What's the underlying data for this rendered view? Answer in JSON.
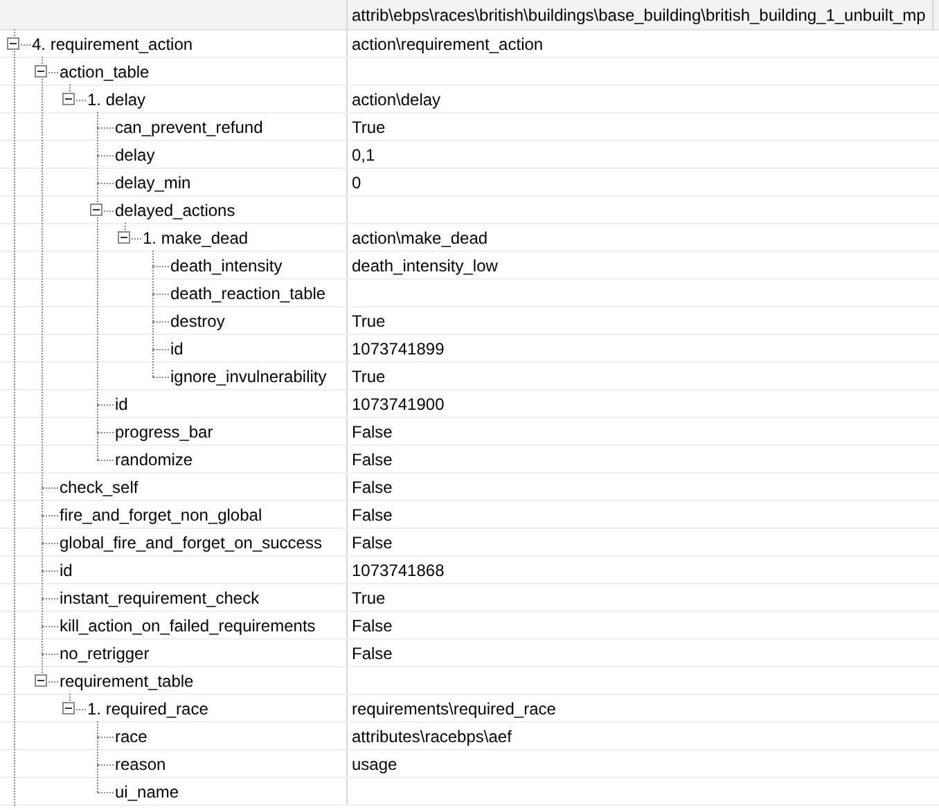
{
  "header": {
    "value_column": "attrib\\ebps\\races\\british\\buildings\\base_building\\british_building_1_unbuilt_mp"
  },
  "tree": [
    {
      "name": "4. requirement_action",
      "value": "action\\requirement_action",
      "expanded": true,
      "children": [
        {
          "name": "action_table",
          "expanded": true,
          "children": [
            {
              "name": "1. delay",
              "value": "action\\delay",
              "expanded": true,
              "children": [
                {
                  "name": "can_prevent_refund",
                  "value": "True"
                },
                {
                  "name": "delay",
                  "value": "0,1"
                },
                {
                  "name": "delay_min",
                  "value": "0"
                },
                {
                  "name": "delayed_actions",
                  "expanded": true,
                  "children": [
                    {
                      "name": "1. make_dead",
                      "value": "action\\make_dead",
                      "expanded": true,
                      "children": [
                        {
                          "name": "death_intensity",
                          "value": "death_intensity_low"
                        },
                        {
                          "name": "death_reaction_table"
                        },
                        {
                          "name": "destroy",
                          "value": "True"
                        },
                        {
                          "name": "id",
                          "value": "1073741899"
                        },
                        {
                          "name": "ignore_invulnerability",
                          "value": "True"
                        }
                      ]
                    }
                  ]
                },
                {
                  "name": "id",
                  "value": "1073741900"
                },
                {
                  "name": "progress_bar",
                  "value": "False"
                },
                {
                  "name": "randomize",
                  "value": "False"
                }
              ]
            }
          ]
        },
        {
          "name": "check_self",
          "value": "False"
        },
        {
          "name": "fire_and_forget_non_global",
          "value": "False"
        },
        {
          "name": "global_fire_and_forget_on_success",
          "value": "False"
        },
        {
          "name": "id",
          "value": "1073741868"
        },
        {
          "name": "instant_requirement_check",
          "value": "True"
        },
        {
          "name": "kill_action_on_failed_requirements",
          "value": "False"
        },
        {
          "name": "no_retrigger",
          "value": "False"
        },
        {
          "name": "requirement_table",
          "expanded": true,
          "children": [
            {
              "name": "1. required_race",
              "value": "requirements\\required_race",
              "expanded": true,
              "children": [
                {
                  "name": "race",
                  "value": "attributes\\racebps\\aef"
                },
                {
                  "name": "reason",
                  "value": "usage"
                },
                {
                  "name": "ui_name"
                }
              ]
            }
          ]
        }
      ]
    }
  ]
}
